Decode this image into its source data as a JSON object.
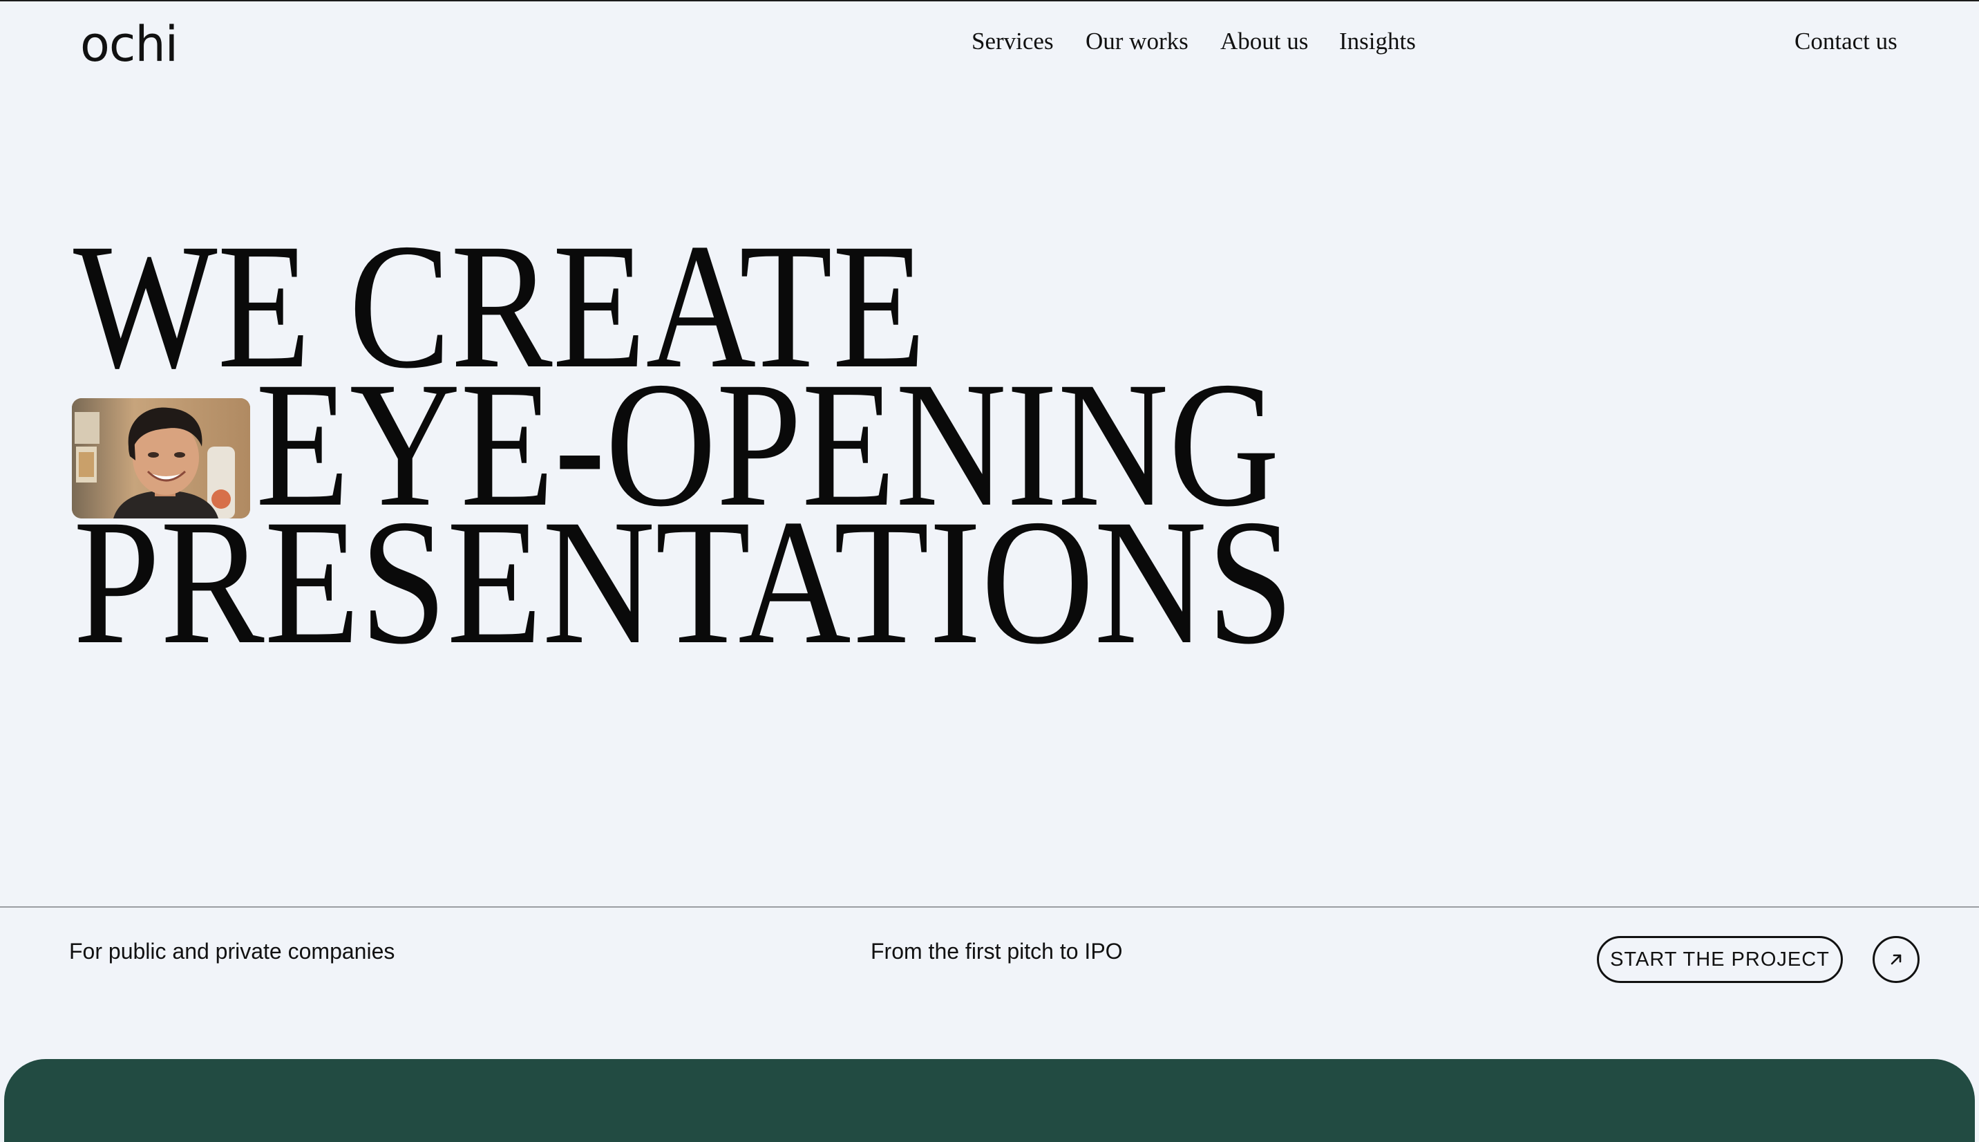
{
  "brand": {
    "logo_text": "ochi"
  },
  "nav": {
    "items": [
      {
        "label": "Services"
      },
      {
        "label": "Our works"
      },
      {
        "label": "About us"
      },
      {
        "label": "Insights"
      }
    ],
    "contact_label": "Contact us"
  },
  "hero": {
    "lines": [
      "WE CREATE",
      "EYE-OPENING",
      "PRESENTATIONS"
    ],
    "photo": {
      "subject": "smiling man portrait"
    }
  },
  "taglines": {
    "left": "For public and private companies",
    "middle": "From the first pitch to IPO"
  },
  "cta": {
    "label": "START THE PROJECT",
    "arrow_icon": "arrow-up-right-icon"
  },
  "colors": {
    "background": "#f1f4f9",
    "text": "#0a0a0a",
    "panel": "#224b42",
    "divider": "#9a9da3"
  }
}
